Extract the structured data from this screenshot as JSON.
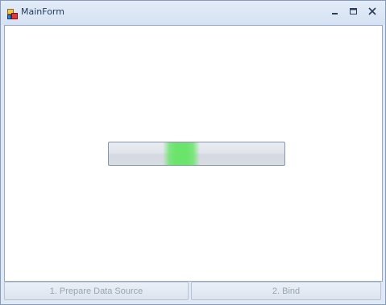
{
  "window": {
    "title": "MainForm",
    "icon": "app-window-icon",
    "controls": [
      "minimize-icon",
      "maximize-icon",
      "close-icon"
    ]
  },
  "progress": {
    "style": "marquee",
    "block_color": "#6be46b",
    "marquee_position": 0.39
  },
  "buttons": {
    "prepare_label": "1. Prepare Data Source",
    "bind_label": "2. Bind",
    "enabled": false
  },
  "colors": {
    "title_text": "#1e395b",
    "frame": "#dfe8f5",
    "disabled_text": "#9aa4b1"
  }
}
